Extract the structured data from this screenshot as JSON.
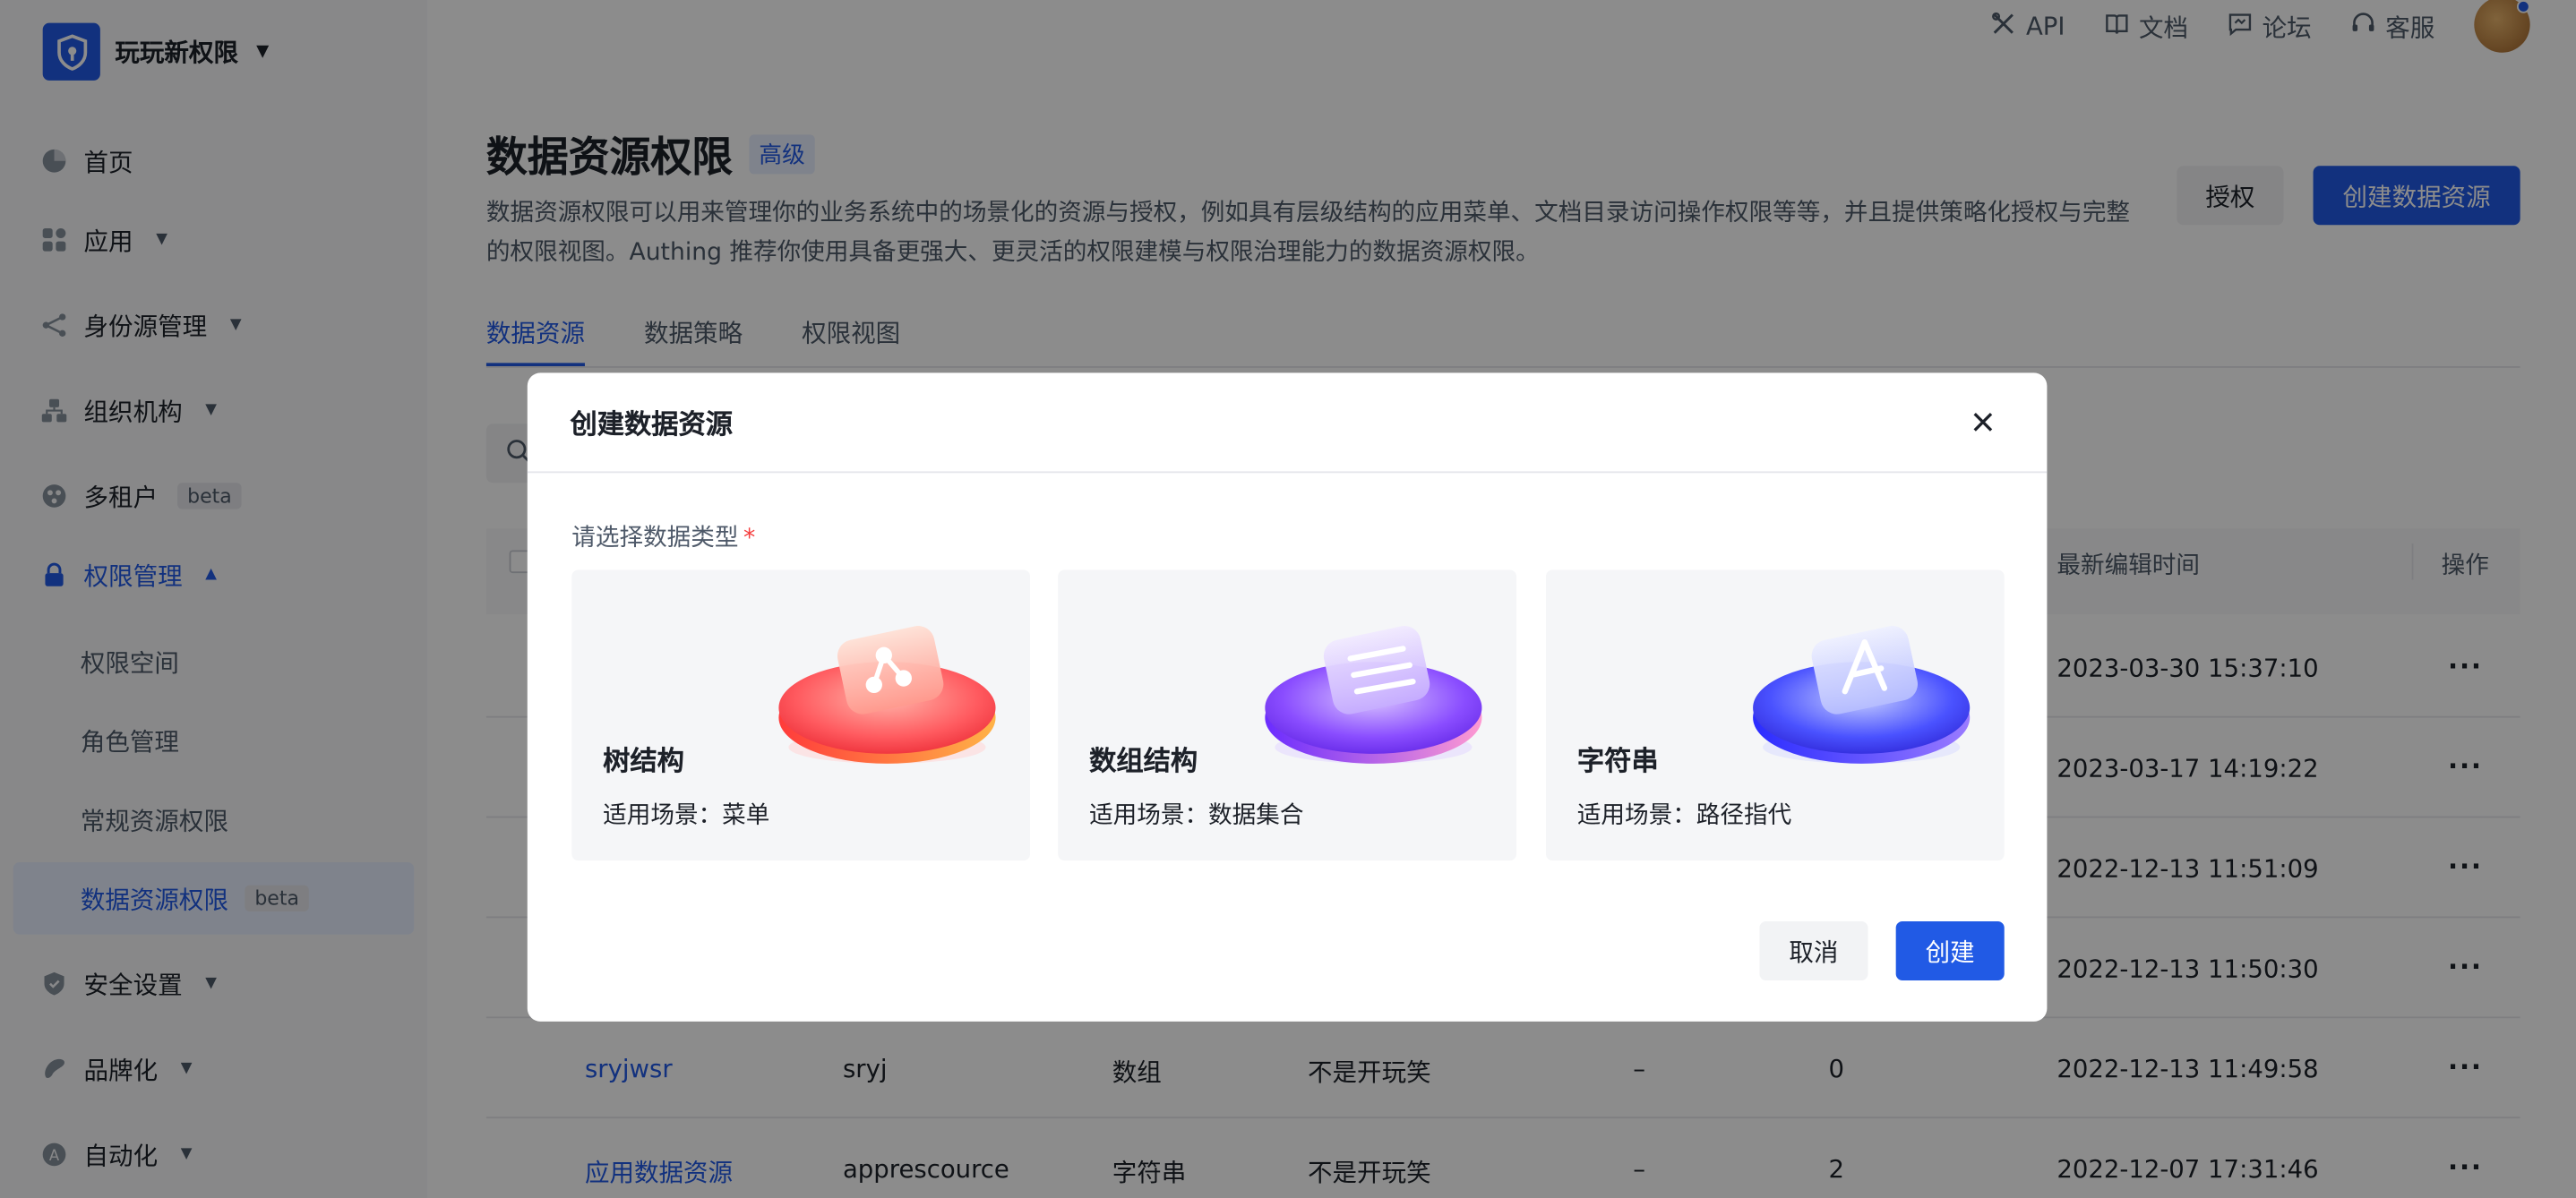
{
  "brand": {
    "name": "玩玩新权限"
  },
  "topbar": {
    "api": "API",
    "docs": "文档",
    "forum": "论坛",
    "support": "客服"
  },
  "sidebar": {
    "items": [
      {
        "label": "首页"
      },
      {
        "label": "应用"
      },
      {
        "label": "身份源管理"
      },
      {
        "label": "组织机构"
      },
      {
        "label": "多租户",
        "badge": "beta"
      },
      {
        "label": "权限管理"
      },
      {
        "label": "安全设置"
      },
      {
        "label": "品牌化"
      },
      {
        "label": "自动化"
      }
    ],
    "sub_items": [
      {
        "label": "权限空间"
      },
      {
        "label": "角色管理"
      },
      {
        "label": "常规资源权限"
      },
      {
        "label": "数据资源权限",
        "badge": "beta"
      }
    ]
  },
  "page": {
    "title": "数据资源权限",
    "title_tag": "高级",
    "description": "数据资源权限可以用来管理你的业务系统中的场景化的资源与授权，例如具有层级结构的应用菜单、文档目录访问操作权限等等，并且提供策略化授权与完整的权限视图。Authing 推荐你使用具备更强大、更灵活的权限建模与权限治理能力的数据资源权限。",
    "grant_button": "授权",
    "create_button": "创建数据资源"
  },
  "tabs": [
    {
      "label": "数据资源"
    },
    {
      "label": "数据策略"
    },
    {
      "label": "权限视图"
    }
  ],
  "table": {
    "headers": {
      "edit_time": "最新编辑时间",
      "actions": "操作"
    },
    "rows": [
      {
        "name": "",
        "code": "",
        "type": "",
        "space": "",
        "desc": "",
        "count": "",
        "time": "2023-03-30 15:37:10"
      },
      {
        "name": "",
        "code": "",
        "type": "",
        "space": "",
        "desc": "",
        "count": "",
        "time": "2023-03-17 14:19:22"
      },
      {
        "name": "",
        "code": "",
        "type": "",
        "space": "",
        "desc": "",
        "count": "",
        "time": "2022-12-13 11:51:09"
      },
      {
        "name": "",
        "code": "",
        "type": "",
        "space": "",
        "desc": "",
        "count": "",
        "time": "2022-12-13 11:50:30"
      },
      {
        "name": "sryjwsr",
        "code": "sryj",
        "type": "数组",
        "space": "不是开玩笑",
        "desc": "–",
        "count": "0",
        "time": "2022-12-13 11:49:58"
      },
      {
        "name": "应用数据资源",
        "code": "apprescource",
        "type": "字符串",
        "space": "不是开玩笑",
        "desc": "–",
        "count": "2",
        "time": "2022-12-07 17:31:46"
      }
    ],
    "more": "···"
  },
  "modal": {
    "title": "创建数据资源",
    "field_label": "请选择数据类型",
    "required_mark": "*",
    "cards": [
      {
        "title": "树结构",
        "subtitle": "适用场景：菜单",
        "icon": "tree-structure-icon"
      },
      {
        "title": "数组结构",
        "subtitle": "适用场景：数据集合",
        "icon": "array-structure-icon"
      },
      {
        "title": "字符串",
        "subtitle": "适用场景：路径指代",
        "icon": "string-icon"
      }
    ],
    "cancel": "取消",
    "create": "创建"
  },
  "colors": {
    "primary": "#215ae5",
    "mask": "rgba(0,0,0,0.45)"
  }
}
